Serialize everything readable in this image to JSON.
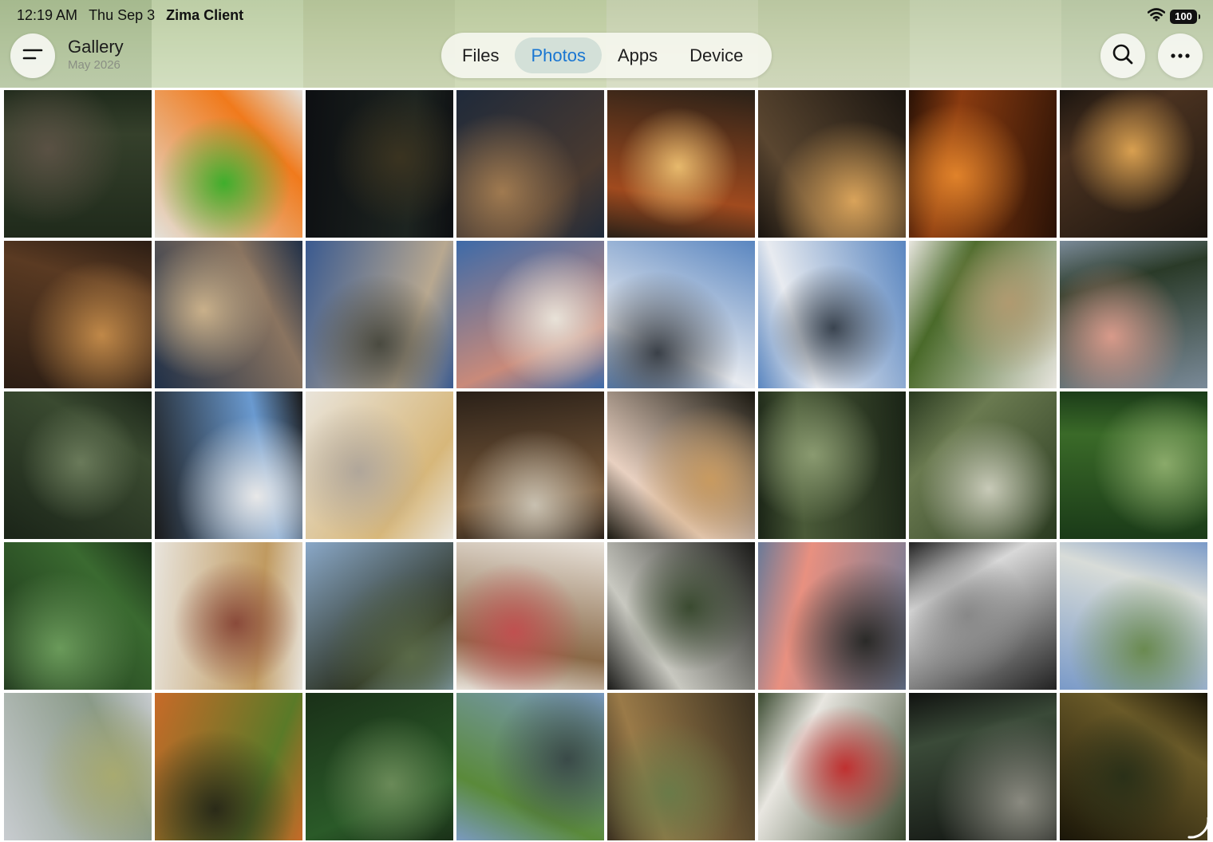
{
  "status_bar": {
    "time": "12:19 AM",
    "date": "Thu Sep 3",
    "app_name": "Zima Client",
    "battery": "100",
    "wifi_icon": "wifi-icon"
  },
  "header": {
    "title": "Gallery",
    "subtitle": "May 2026",
    "menu_icon": "menu-icon",
    "search_icon": "search-icon",
    "more_icon": "more-icon",
    "tabs": [
      {
        "label": "Files",
        "active": false
      },
      {
        "label": "Photos",
        "active": true
      },
      {
        "label": "Apps",
        "active": false
      },
      {
        "label": "Device",
        "active": false
      }
    ],
    "accent_color": "#1976d2"
  },
  "photos": [
    {
      "subject": "dark foliage and rubbish",
      "colors": [
        "#1f2a1b",
        "#35402b",
        "#5a5144"
      ]
    },
    {
      "subject": "orange and green toy rockers",
      "colors": [
        "#e4e0d8",
        "#f07a1c",
        "#3fae2c"
      ]
    },
    {
      "subject": "night square with billboard",
      "colors": [
        "#0d0f12",
        "#1d2420",
        "#3a3320"
      ]
    },
    {
      "subject": "evening street with people",
      "colors": [
        "#1f2a3a",
        "#4a3a30",
        "#a07a50"
      ]
    },
    {
      "subject": "red tram at night",
      "colors": [
        "#2a2118",
        "#a04a1e",
        "#e7b96c"
      ]
    },
    {
      "subject": "shop window with lights",
      "colors": [
        "#1a1510",
        "#5a4630",
        "#d9a35a"
      ]
    },
    {
      "subject": "orange lit wall at night",
      "colors": [
        "#2a1206",
        "#8a3b10",
        "#e0822a"
      ]
    },
    {
      "subject": "arched shop windows",
      "colors": [
        "#1a140f",
        "#4a3220",
        "#d9a050"
      ]
    },
    {
      "subject": "lit building corner",
      "colors": [
        "#2b1d14",
        "#5a3a22",
        "#c08848"
      ]
    },
    {
      "subject": "long building facade at dusk",
      "colors": [
        "#203048",
        "#8a7460",
        "#c9b08a"
      ]
    },
    {
      "subject": "old town street blue sky",
      "colors": [
        "#3a5a90",
        "#b8a890",
        "#4a4a40"
      ]
    },
    {
      "subject": "pink and white facades",
      "colors": [
        "#3d6aa8",
        "#c98a7a",
        "#e8e2d8"
      ]
    },
    {
      "subject": "clouds and tower",
      "colors": [
        "#5a86c0",
        "#e8ebf0",
        "#3a4048"
      ]
    },
    {
      "subject": "clouds and glass building",
      "colors": [
        "#5a86c0",
        "#e8ebf0",
        "#3a4450"
      ]
    },
    {
      "subject": "porch with plant",
      "colors": [
        "#e8e6df",
        "#4a6a2a",
        "#b09a70"
      ]
    },
    {
      "subject": "mountain valley at sunset",
      "colors": [
        "#7a8a98",
        "#2a3a28",
        "#d89a8a"
      ]
    },
    {
      "subject": "tall forest trunks",
      "colors": [
        "#1a2418",
        "#3a4a30",
        "#6a7a5a"
      ]
    },
    {
      "subject": "window with sky view",
      "colors": [
        "#1a1a1a",
        "#6a9ad0",
        "#e8e8e8"
      ]
    },
    {
      "subject": "kitten on yellow pillow",
      "colors": [
        "#e9e4da",
        "#d7b77a",
        "#b0a69a"
      ]
    },
    {
      "subject": "cozy room with shelves",
      "colors": [
        "#2a2018",
        "#7a5a3a",
        "#c8c0b0"
      ]
    },
    {
      "subject": "bouquet of flowers",
      "colors": [
        "#1a1810",
        "#e8d0c0",
        "#c89a60"
      ]
    },
    {
      "subject": "shadowed wall and leaves",
      "colors": [
        "#1a2416",
        "#4a5a38",
        "#8a9a70"
      ]
    },
    {
      "subject": "garden wall and trees",
      "colors": [
        "#2a3a20",
        "#6a7a50",
        "#c8cab8"
      ]
    },
    {
      "subject": "green forest",
      "colors": [
        "#1a3a18",
        "#3a6a28",
        "#8aaa6a"
      ]
    },
    {
      "subject": "ravine with vegetation",
      "colors": [
        "#1a3018",
        "#3a6a30",
        "#6a9a5a"
      ]
    },
    {
      "subject": "cake and coffee",
      "colors": [
        "#e8e4dc",
        "#c09a60",
        "#8a4a3a"
      ]
    },
    {
      "subject": "balcony view of mountains",
      "colors": [
        "#8aa8c8",
        "#2a3020",
        "#5a6a48"
      ]
    },
    {
      "subject": "tea table with dishes",
      "colors": [
        "#e8e2da",
        "#8a6a48",
        "#c05050"
      ]
    },
    {
      "subject": "shutters and tree",
      "colors": [
        "#1a1a18",
        "#c8c8c0",
        "#3a4a30"
      ]
    },
    {
      "subject": "pink sunset over hills",
      "colors": [
        "#6a7a98",
        "#e89080",
        "#2a2a28"
      ]
    },
    {
      "subject": "postcards on dark table",
      "colors": [
        "#222222",
        "#d8d8d8",
        "#888888"
      ]
    },
    {
      "subject": "misty grassland",
      "colors": [
        "#7a9ac8",
        "#d8dcd8",
        "#6a8a50"
      ]
    },
    {
      "subject": "fog over meadow",
      "colors": [
        "#c8ccd0",
        "#8a9a88",
        "#a8aa70"
      ]
    },
    {
      "subject": "lotus seed pods on table",
      "colors": [
        "#c86a28",
        "#5a7a28",
        "#2a2a18"
      ]
    },
    {
      "subject": "green garden with bamboo",
      "colors": [
        "#1a3018",
        "#2a5a28",
        "#6a8a58"
      ]
    },
    {
      "subject": "lake with grassy hill",
      "colors": [
        "#7a9ac0",
        "#5a8a3a",
        "#3a4a48"
      ]
    },
    {
      "subject": "market stall interior",
      "colors": [
        "#3a3020",
        "#9a7a48",
        "#6a7a48"
      ]
    },
    {
      "subject": "directional signpost",
      "colors": [
        "#3a4a30",
        "#e8e6e0",
        "#c03030"
      ]
    },
    {
      "subject": "dark street corner",
      "colors": [
        "#101210",
        "#3a4a38",
        "#8a8a80"
      ]
    },
    {
      "subject": "tree canopy at dusk",
      "colors": [
        "#1a1608",
        "#6a5a28",
        "#2a3018"
      ]
    }
  ]
}
